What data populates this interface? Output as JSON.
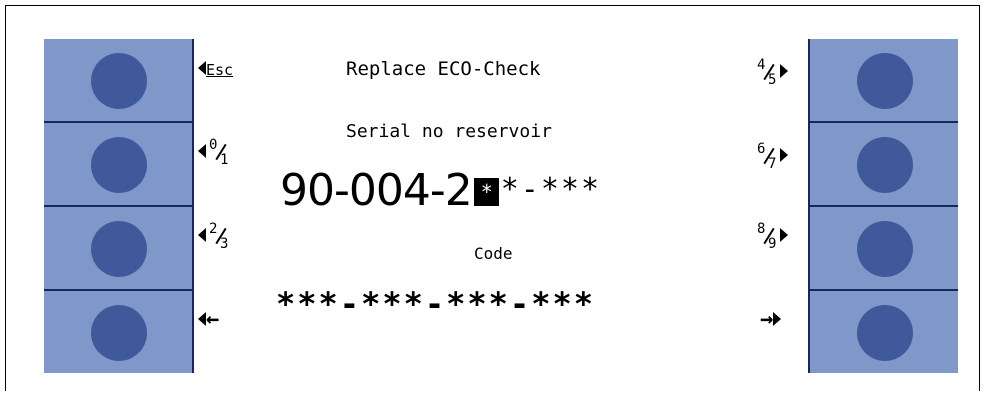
{
  "screen": {
    "title": "Replace ECO-Check",
    "serial_label": "Serial no reservoir",
    "serial_prefix": "90-004-2",
    "serial_cursor": "*",
    "serial_rest": "*-***",
    "code_label": "Code",
    "code_value": "***-***-***-***"
  },
  "softkeys": {
    "left": [
      {
        "label": "Esc"
      },
      {
        "num": "0",
        "den": "1"
      },
      {
        "num": "2",
        "den": "3"
      },
      {
        "label": "←"
      }
    ],
    "right": [
      {
        "num": "4",
        "den": "5"
      },
      {
        "num": "6",
        "den": "7"
      },
      {
        "num": "8",
        "den": "9"
      },
      {
        "label": "→"
      }
    ]
  },
  "colors": {
    "button_panel": "#7f97c9",
    "button": "#40599a",
    "divider": "#16285a"
  }
}
